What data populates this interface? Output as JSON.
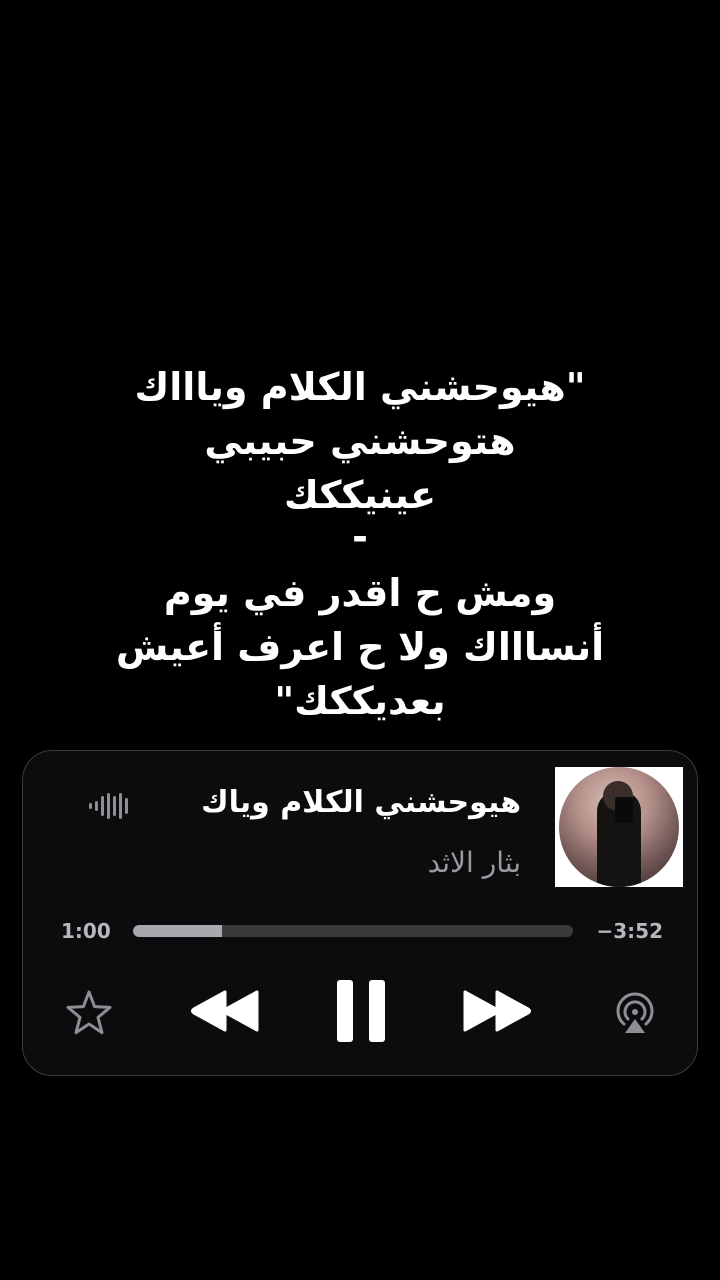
{
  "lyrics": {
    "lines": [
      "\"هيوحشني الكلام وياااك",
      "هتوحشني حبيبي",
      "عينيككك",
      "-",
      "ومش ح اقدر في يوم",
      "أنساااك ولا ح اعرف أعيش",
      "بعديككك\""
    ]
  },
  "player": {
    "title": "هيوحشني الكلام وياك",
    "artist": "بثار الاثد",
    "time_elapsed": "1:00",
    "time_remaining": "−3:52",
    "progress": 0.203,
    "icons": {
      "waveform": "waveform-icon",
      "star": "star-icon",
      "rewind": "rewind-icon",
      "pause": "pause-icon",
      "forward": "fast-forward-icon",
      "airplay": "airplay-icon"
    },
    "colors": {
      "background": "#0c0c0e",
      "track": "#3a3a3d",
      "fill": "#a8a8ae",
      "secondary_text": "#9a9a9f"
    }
  }
}
